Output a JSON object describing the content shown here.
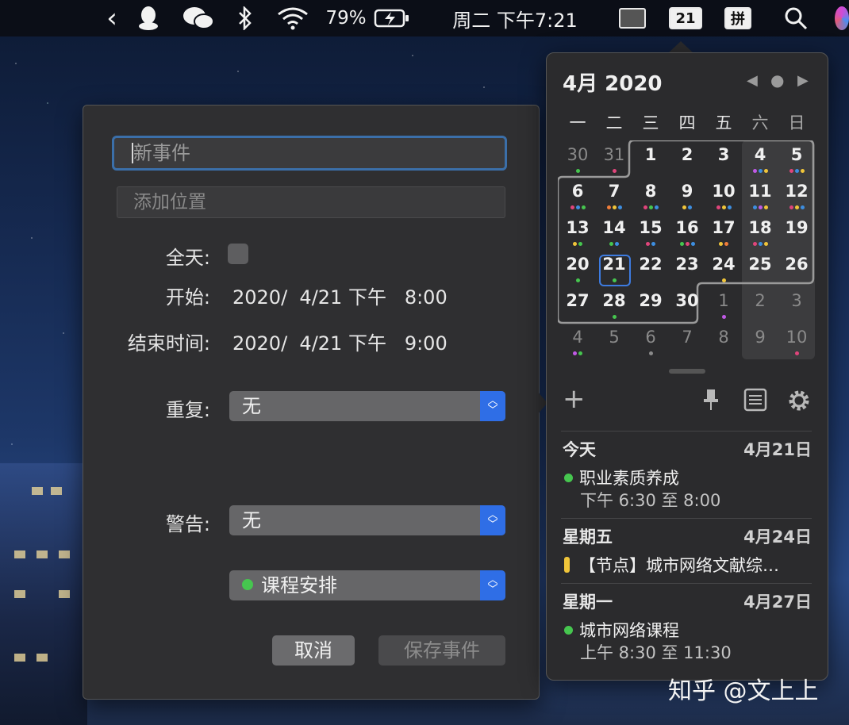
{
  "colors": {
    "accent": "#2f6ee6",
    "today_outline": "#3d7be0",
    "green": "#46c64f",
    "yellow": "#f0c53a"
  },
  "menubar": {
    "back_glyph": "‹",
    "battery": "79%",
    "clock": "周二 下午7:21",
    "calendar_badge": "21",
    "input_method": "拼"
  },
  "event_form": {
    "title_placeholder": "新事件",
    "location_placeholder": "添加位置",
    "allday_label": "全天:",
    "start_label": "开始:",
    "start_value": "2020/  4/21 下午   8:00",
    "end_label": "结束时间:",
    "end_value": "2020/  4/21 下午   9:00",
    "repeat_label": "重复:",
    "repeat_value": "无",
    "alert_label": "警告:",
    "alert_value": "无",
    "calendar_value": "课程安排",
    "cancel_label": "取消",
    "save_label": "保存事件"
  },
  "calendar": {
    "month_title": "4月 2020",
    "weekdays": [
      "一",
      "二",
      "三",
      "四",
      "五",
      "六",
      "日"
    ],
    "weeks": [
      [
        "30",
        "31",
        "1",
        "2",
        "3",
        "4",
        "5"
      ],
      [
        "6",
        "7",
        "8",
        "9",
        "10",
        "11",
        "12"
      ],
      [
        "13",
        "14",
        "15",
        "16",
        "17",
        "18",
        "19"
      ],
      [
        "20",
        "21",
        "22",
        "23",
        "24",
        "25",
        "26"
      ],
      [
        "27",
        "28",
        "29",
        "30",
        "1",
        "2",
        "3"
      ],
      [
        "4",
        "5",
        "6",
        "7",
        "8",
        "9",
        "10"
      ]
    ],
    "today": "21"
  },
  "agenda": [
    {
      "header": "今天",
      "date": "4月21日",
      "title": "职业素质养成",
      "time": "下午 6:30 至 8:00",
      "marker": "dot",
      "color": "#46c64f"
    },
    {
      "header": "星期五",
      "date": "4月24日",
      "title": "【节点】城市网络文献综…",
      "time": "",
      "marker": "bar",
      "color": "#f0c53a"
    },
    {
      "header": "星期一",
      "date": "4月27日",
      "title": "城市网络课程",
      "time": "上午 8:30 至 11:30",
      "marker": "dot",
      "color": "#46c64f"
    }
  ],
  "watermark": "知乎 @文上上"
}
